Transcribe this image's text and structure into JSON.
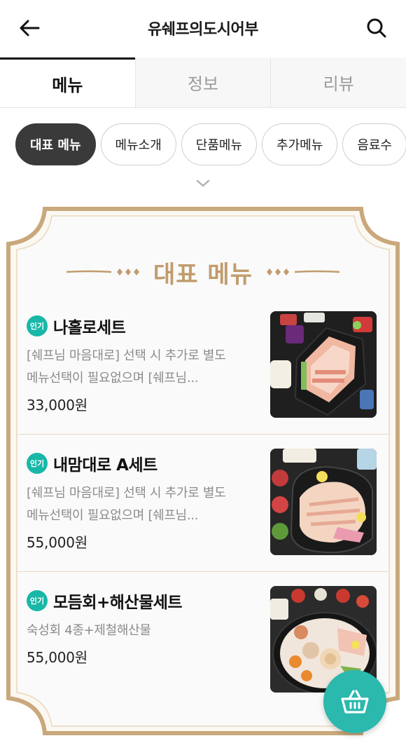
{
  "header": {
    "title": "유쉐프의도시어부",
    "back_icon": "arrow-left-icon",
    "search_icon": "search-icon"
  },
  "tabs": [
    {
      "label": "메뉴",
      "active": true
    },
    {
      "label": "정보",
      "active": false
    },
    {
      "label": "리뷰",
      "active": false
    }
  ],
  "chips": [
    {
      "label": "대표 메뉴",
      "active": true
    },
    {
      "label": "메뉴소개",
      "active": false
    },
    {
      "label": "단품메뉴",
      "active": false
    },
    {
      "label": "추가메뉴",
      "active": false
    },
    {
      "label": "음료수",
      "active": false
    }
  ],
  "section": {
    "title": "대표 메뉴",
    "accent_color": "#c19c6c"
  },
  "menu_items": [
    {
      "badge": "인기",
      "name": "나홀로세트",
      "desc_line1": "[쉐프님 마음대로] 선택 시 추가로 별도",
      "desc_line2": "메뉴선택이 필요없으며 [쉐프님...",
      "price": "33,000원"
    },
    {
      "badge": "인기",
      "name": "내맘대로 A세트",
      "desc_line1": "[쉐프님 마음대로] 선택 시 추가로 별도",
      "desc_line2": "메뉴선택이 필요없으며 [쉐프님...",
      "price": "55,000원"
    },
    {
      "badge": "인기",
      "name": "모듬회+해산물세트",
      "desc_line1": "숙성회 4종+제철해산물",
      "desc_line2": "",
      "price": "55,000원"
    }
  ],
  "fab": {
    "icon": "basket-icon",
    "color": "#2bb8ad"
  },
  "colors": {
    "badge": "#18b7a8",
    "frame": "#c9a87c"
  }
}
